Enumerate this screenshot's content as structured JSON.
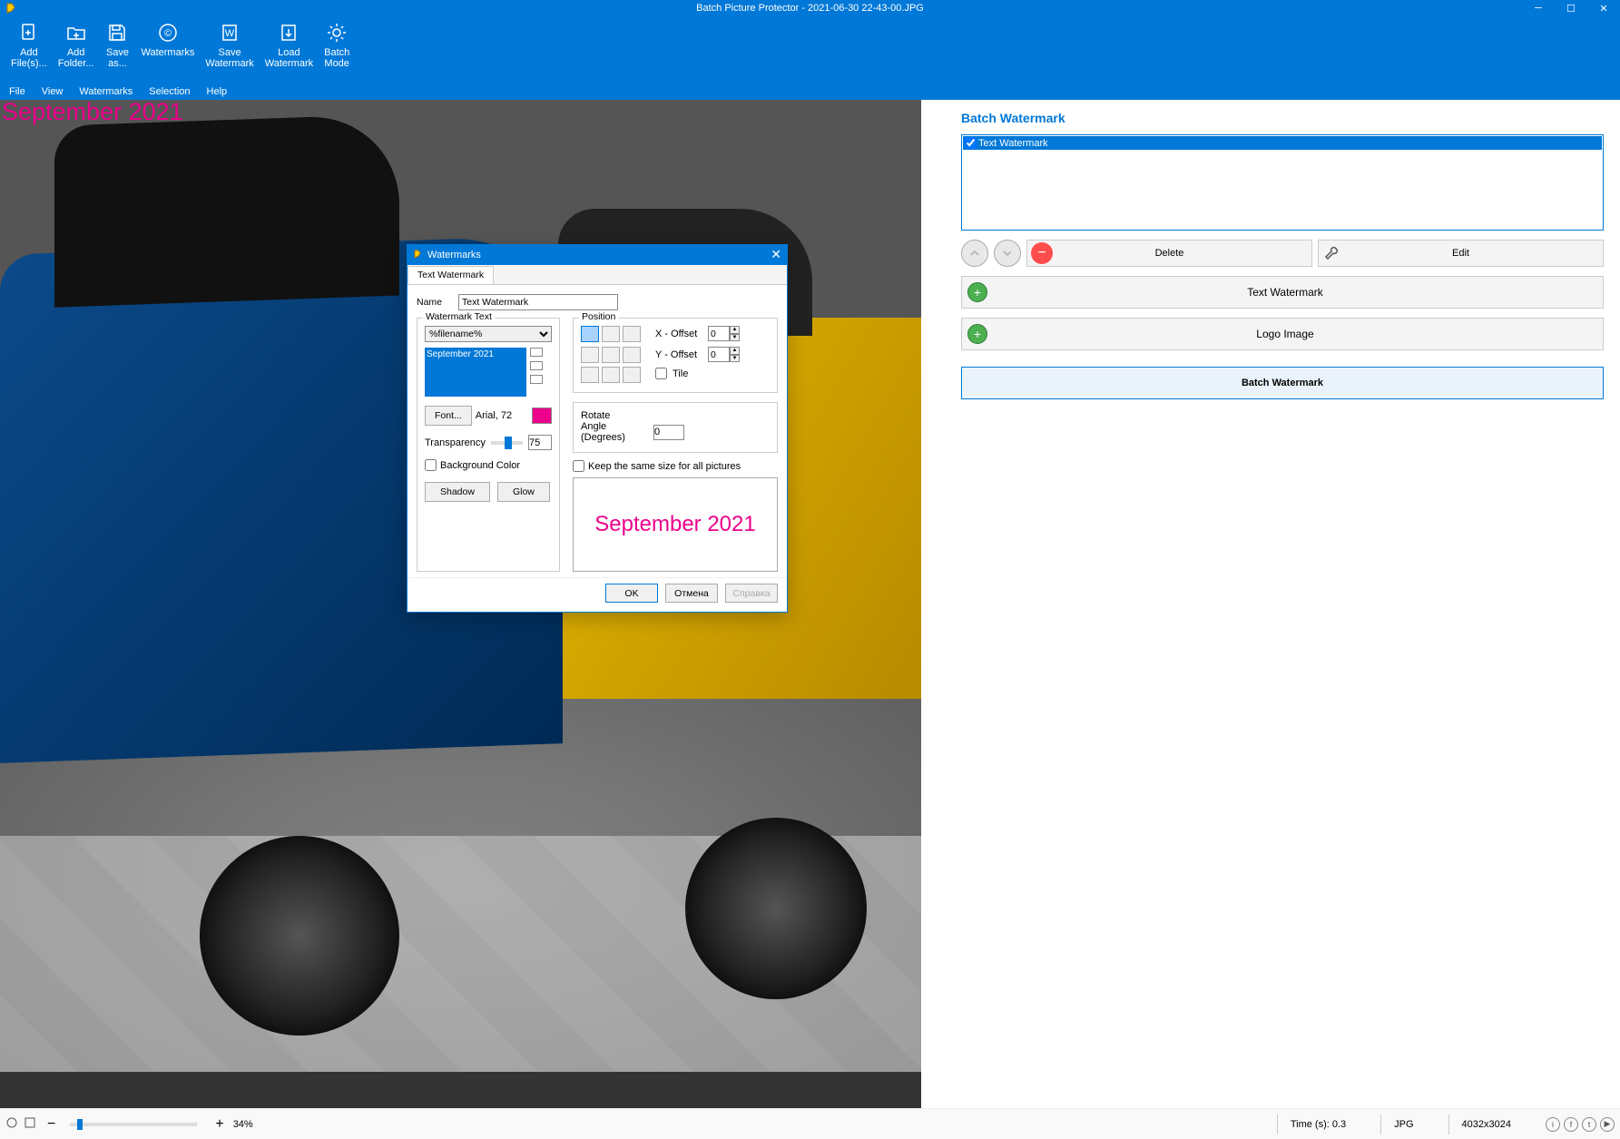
{
  "window": {
    "title": "Batch Picture Protector - 2021-06-30 22-43-00.JPG"
  },
  "ribbon": [
    {
      "label": "Add\nFile(s)..."
    },
    {
      "label": "Add\nFolder..."
    },
    {
      "label": "Save\nas..."
    },
    {
      "label": "Watermarks"
    },
    {
      "label": "Save\nWatermark"
    },
    {
      "label": "Load\nWatermark"
    },
    {
      "label": "Batch\nMode"
    }
  ],
  "menu": [
    "File",
    "View",
    "Watermarks",
    "Selection",
    "Help"
  ],
  "overlay_text": "September 2021",
  "side": {
    "title": "Batch Watermark",
    "list_item": "Text Watermark",
    "delete": "Delete",
    "edit": "Edit",
    "text_wm": "Text Watermark",
    "logo_img": "Logo Image",
    "batch": "Batch Watermark"
  },
  "status": {
    "zoom": "34%",
    "time": "Time (s): 0.3",
    "format": "JPG",
    "dims": "4032x3024"
  },
  "dialog": {
    "title": "Watermarks",
    "tab": "Text Watermark",
    "name_label": "Name",
    "name_value": "Text Watermark",
    "wm_text_label": "Watermark Text",
    "token": "%filename%",
    "textarea": "September 2021",
    "font_btn": "Font...",
    "font_desc": "Arial, 72",
    "transparency_label": "Transparency",
    "transparency_value": "75",
    "bg_color": "Background Color",
    "shadow": "Shadow",
    "glow": "Glow",
    "position": "Position",
    "x_off": "X - Offset",
    "y_off": "Y - Offset",
    "x_val": "0",
    "y_val": "0",
    "tile": "Tile",
    "rotate": "Rotate",
    "angle": "Angle (Degrees)",
    "angle_val": "0",
    "keepsame": "Keep the same size for all pictures",
    "preview": "September 2021",
    "ok": "OK",
    "cancel": "Отмена",
    "help": "Справка"
  }
}
